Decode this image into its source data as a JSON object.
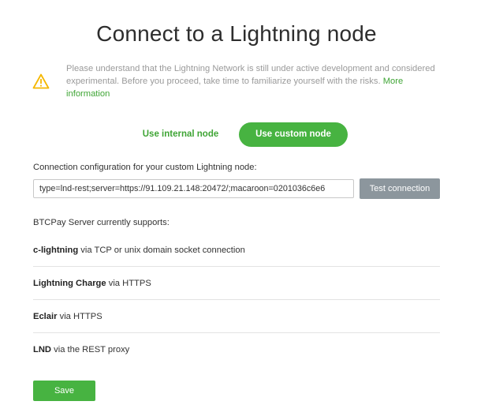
{
  "page": {
    "title": "Connect to a Lightning node"
  },
  "warning": {
    "icon": "warning-triangle-icon",
    "icon_color": "#f5b700",
    "text": "Please understand that the Lightning Network is still under active development and considered experimental. Before you proceed, take time to familiarize yourself with the risks.",
    "link_label": "More information"
  },
  "node_toggle": {
    "internal_label": "Use internal node",
    "custom_label": "Use custom node",
    "selected": "custom"
  },
  "connection": {
    "label": "Connection configuration for your custom Lightning node:",
    "value": "type=lnd-rest;server=https://91.109.21.148:20472/;macaroon=0201036c6e6",
    "test_button_label": "Test connection"
  },
  "supports": {
    "label": "BTCPay Server currently supports:",
    "items": [
      {
        "name": "c-lightning",
        "detail": "via TCP or unix domain socket connection"
      },
      {
        "name": "Lightning Charge",
        "detail": "via HTTPS"
      },
      {
        "name": "Eclair",
        "detail": "via HTTPS"
      },
      {
        "name": "LND",
        "detail": "via the REST proxy"
      }
    ]
  },
  "actions": {
    "save_label": "Save"
  },
  "colors": {
    "accent_green": "#47b341",
    "link_green": "#3fa535",
    "muted_button": "#8c969d"
  }
}
